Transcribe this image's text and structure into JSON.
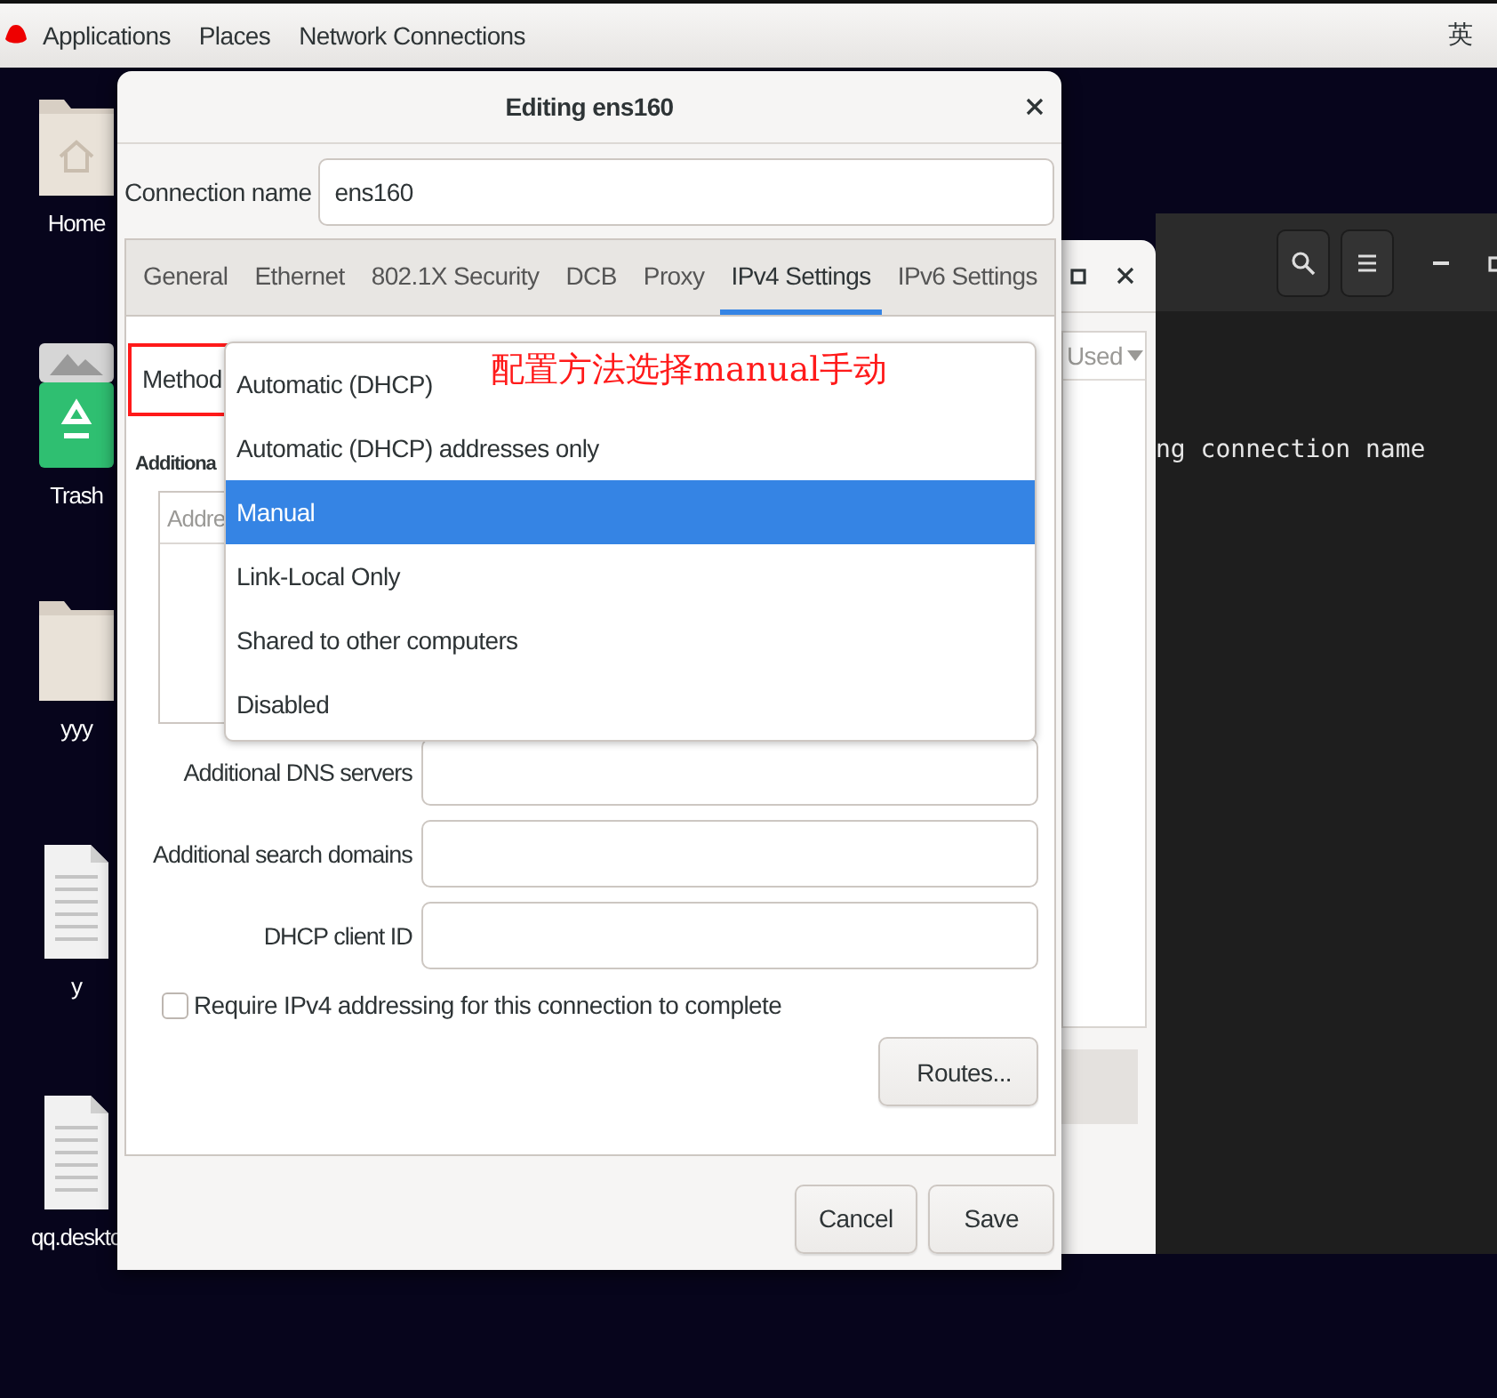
{
  "top_bar": {
    "items": [
      {
        "label": "Applications"
      },
      {
        "label": "Places"
      },
      {
        "label": "Network Connections"
      }
    ],
    "input_method": "英"
  },
  "desktop_icons": [
    {
      "label": "Home",
      "kind": "home"
    },
    {
      "label": "Trash",
      "kind": "trash"
    },
    {
      "label": "yyy",
      "kind": "folder"
    },
    {
      "label": "y",
      "kind": "document"
    },
    {
      "label": "qq.deskto",
      "kind": "document"
    }
  ],
  "background_window": {
    "column_header": "Used"
  },
  "terminal": {
    "lines": [
      "ng connection name"
    ]
  },
  "dialog": {
    "title": "Editing ens160",
    "connection_name_label": "Connection name",
    "connection_name": "ens160",
    "tabs": [
      {
        "label": "General",
        "selected": false
      },
      {
        "label": "Ethernet",
        "selected": false
      },
      {
        "label": "802.1X Security",
        "selected": false
      },
      {
        "label": "DCB",
        "selected": false
      },
      {
        "label": "Proxy",
        "selected": false
      },
      {
        "label": "IPv4 Settings",
        "selected": true
      },
      {
        "label": "IPv6 Settings",
        "selected": false
      }
    ],
    "method_label": "Method",
    "method_options": [
      {
        "label": "Automatic (DHCP)",
        "selected": false
      },
      {
        "label": "Automatic (DHCP) addresses only",
        "selected": false
      },
      {
        "label": "Manual",
        "selected": true
      },
      {
        "label": "Link-Local Only",
        "selected": false
      },
      {
        "label": "Shared to other computers",
        "selected": false
      },
      {
        "label": "Disabled",
        "selected": false
      }
    ],
    "addresses_label": "Additiona",
    "address_column": "Addre",
    "fields": [
      {
        "label": "Additional DNS servers"
      },
      {
        "label": "Additional search domains"
      },
      {
        "label": "DHCP client ID"
      }
    ],
    "require_ipv4": {
      "label": "Require IPv4 addressing for this connection to complete",
      "checked": false
    },
    "routes_button": "Routes...",
    "buttons": [
      "Cancel",
      "Save"
    ]
  },
  "annotation": {
    "text": "配置方法选择manual手动"
  }
}
